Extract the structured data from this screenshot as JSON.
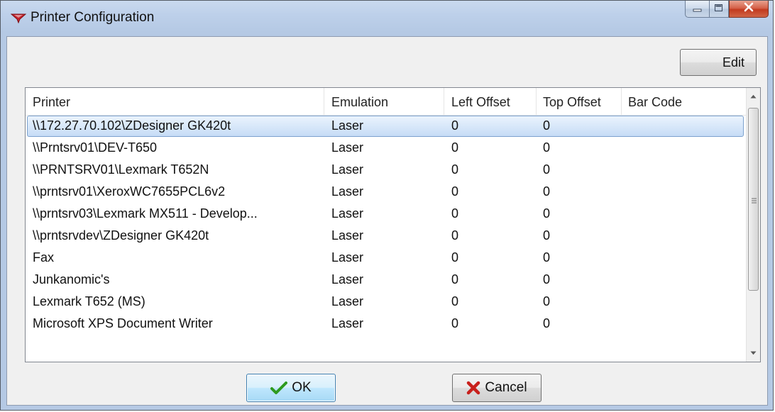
{
  "window": {
    "title": "Printer Configuration"
  },
  "toolbar": {
    "edit_label": "Edit"
  },
  "printer_list": {
    "columns": [
      "Printer",
      "Emulation",
      "Left Offset",
      "Top Offset",
      "Bar Code"
    ],
    "selected_index": 0,
    "rows": [
      {
        "printer": "\\\\172.27.70.102\\ZDesigner GK420t",
        "emulation": "Laser",
        "left_offset": "0",
        "top_offset": "0",
        "bar_code": ""
      },
      {
        "printer": "\\\\Prntsrv01\\DEV-T650",
        "emulation": "Laser",
        "left_offset": "0",
        "top_offset": "0",
        "bar_code": ""
      },
      {
        "printer": "\\\\PRNTSRV01\\Lexmark T652N",
        "emulation": "Laser",
        "left_offset": "0",
        "top_offset": "0",
        "bar_code": ""
      },
      {
        "printer": "\\\\prntsrv01\\XeroxWC7655PCL6v2",
        "emulation": "Laser",
        "left_offset": "0",
        "top_offset": "0",
        "bar_code": ""
      },
      {
        "printer": "\\\\prntsrv03\\Lexmark MX511 - Develop...",
        "emulation": "Laser",
        "left_offset": "0",
        "top_offset": "0",
        "bar_code": ""
      },
      {
        "printer": "\\\\prntsrvdev\\ZDesigner GK420t",
        "emulation": "Laser",
        "left_offset": "0",
        "top_offset": "0",
        "bar_code": ""
      },
      {
        "printer": "Fax",
        "emulation": "Laser",
        "left_offset": "0",
        "top_offset": "0",
        "bar_code": ""
      },
      {
        "printer": "Junkanomic's",
        "emulation": "Laser",
        "left_offset": "0",
        "top_offset": "0",
        "bar_code": ""
      },
      {
        "printer": "Lexmark T652 (MS)",
        "emulation": "Laser",
        "left_offset": "0",
        "top_offset": "0",
        "bar_code": ""
      },
      {
        "printer": "Microsoft XPS Document Writer",
        "emulation": "Laser",
        "left_offset": "0",
        "top_offset": "0",
        "bar_code": ""
      }
    ]
  },
  "buttons": {
    "ok_label": "OK",
    "cancel_label": "Cancel"
  },
  "icons": {
    "app": "printer-app-icon",
    "minimize": "minimize-icon",
    "maximize": "maximize-icon",
    "close": "close-icon",
    "ok": "checkmark-icon",
    "cancel": "red-x-icon",
    "scroll_up": "chevron-up-icon",
    "scroll_down": "chevron-down-icon"
  },
  "colors": {
    "close_button": "#c23a1f",
    "selection": "#c6dcf6",
    "checkmark": "#2e9a1e",
    "cancel_x": "#c8201c"
  }
}
